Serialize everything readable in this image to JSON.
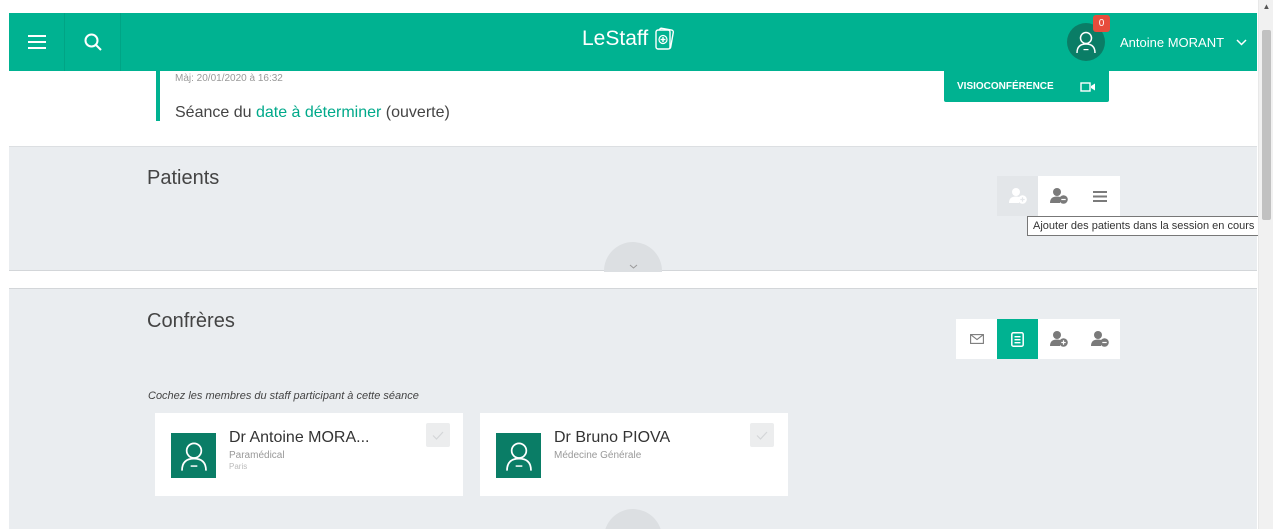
{
  "header": {
    "app_name": "LeStaff",
    "notification_count": "0",
    "user_name": "Antoine MORANT"
  },
  "session": {
    "updated": "Màj: 20/01/2020 à 16:32",
    "title_prefix": "Séance du ",
    "title_link": "date à déterminer",
    "title_suffix": " (ouverte)",
    "visio_label": "VISIOCONFÉRENCE"
  },
  "patients": {
    "title": "Patients",
    "tooltip": "Ajouter des patients dans la session en cours"
  },
  "confreres": {
    "title": "Confrères",
    "instruction": "Cochez les membres du staff participant à cette séance",
    "members": [
      {
        "name": "Dr Antoine MORA...",
        "role": "Paramédical",
        "city": "Paris"
      },
      {
        "name": "Dr Bruno PIOVA",
        "role": "Médecine Générale",
        "city": ""
      }
    ]
  },
  "colors": {
    "brand": "#00b291",
    "brand_dark": "#0a7d66",
    "badge": "#e74c3c",
    "panel_bg": "#eaedf0"
  }
}
